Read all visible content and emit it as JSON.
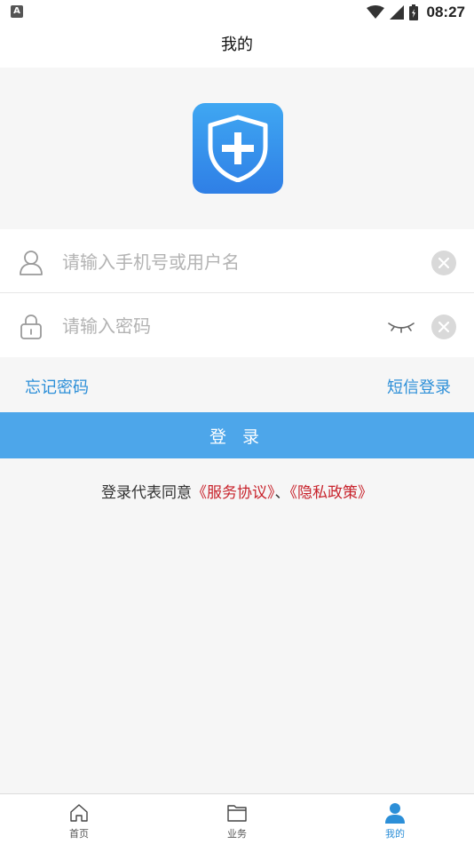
{
  "status_bar": {
    "notification_badge": "A",
    "time": "08:27",
    "icons": [
      "wifi-icon",
      "cellular-signal-icon",
      "battery-icon"
    ]
  },
  "header": {
    "title": "我的"
  },
  "form": {
    "username_placeholder": "请输入手机号或用户名",
    "username_value": "",
    "password_placeholder": "请输入密码",
    "password_value": ""
  },
  "links": {
    "forgot_password": "忘记密码",
    "sms_login": "短信登录"
  },
  "login_button": {
    "label": "登 录"
  },
  "agreement": {
    "prefix": "登录代表同意",
    "service_agreement": "《服务协议》",
    "separator": "、",
    "privacy_policy": "《隐私政策》"
  },
  "tabbar": {
    "items": [
      {
        "label": "首页",
        "icon": "home-icon",
        "active": false
      },
      {
        "label": "业务",
        "icon": "folder-icon",
        "active": false
      },
      {
        "label": "我的",
        "icon": "user-icon",
        "active": true
      }
    ]
  },
  "colors": {
    "accent": "#4da6ea",
    "link": "#2c8fd8",
    "agreement_link": "#c8232c",
    "logo_top": "#3fa7f2",
    "logo_bottom": "#2f7fe6"
  }
}
